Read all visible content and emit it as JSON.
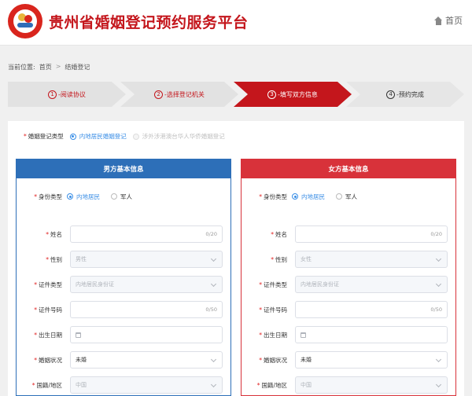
{
  "header": {
    "site_title": "贵州省婚姻登记预约服务平台",
    "home_label": "首页"
  },
  "breadcrumb": {
    "prefix": "当前位置:",
    "home": "首页",
    "separator": ">",
    "current": "结婚登记"
  },
  "steps": [
    {
      "num": "1",
      "label": "-阅读协议",
      "state": "done"
    },
    {
      "num": "2",
      "label": "-选择登记机关",
      "state": "done"
    },
    {
      "num": "3",
      "label": "-填写双方信息",
      "state": "active"
    },
    {
      "num": "4",
      "label": "-预约完成",
      "state": "todo"
    }
  ],
  "registration_type": {
    "label": "婚姻登记类型",
    "options": [
      {
        "label": "内地居民婚姻登记",
        "checked": true
      },
      {
        "label": "涉外涉港澳台华人华侨婚姻登记",
        "disabled": true
      }
    ]
  },
  "male": {
    "title": "男方基本信息",
    "identity_label": "身份类型",
    "identity_options": [
      "内地居民",
      "军人"
    ],
    "name_label": "姓名",
    "name_value": "",
    "name_count": "0/20",
    "gender_label": "性别",
    "gender_value": "男性",
    "id_type_label": "证件类型",
    "id_type_value": "内地居民身份证",
    "id_no_label": "证件号码",
    "id_no_value": "",
    "id_no_count": "0/50",
    "birth_label": "出生日期",
    "birth_value": "",
    "marital_label": "婚姻状况",
    "marital_value": "未婚",
    "nation_label": "国籍/地区",
    "nation_value": "中国"
  },
  "female": {
    "title": "女方基本信息",
    "identity_label": "身份类型",
    "identity_options": [
      "内地居民",
      "军人"
    ],
    "name_label": "姓名",
    "name_value": "",
    "name_count": "0/20",
    "gender_label": "性别",
    "gender_value": "女性",
    "id_type_label": "证件类型",
    "id_type_value": "内地居民身份证",
    "id_no_label": "证件号码",
    "id_no_value": "",
    "id_no_count": "0/50",
    "birth_label": "出生日期",
    "birth_value": "",
    "marital_label": "婚姻状况",
    "marital_value": "未婚",
    "nation_label": "国籍/地区",
    "nation_value": "中国"
  },
  "required_mark": "*"
}
